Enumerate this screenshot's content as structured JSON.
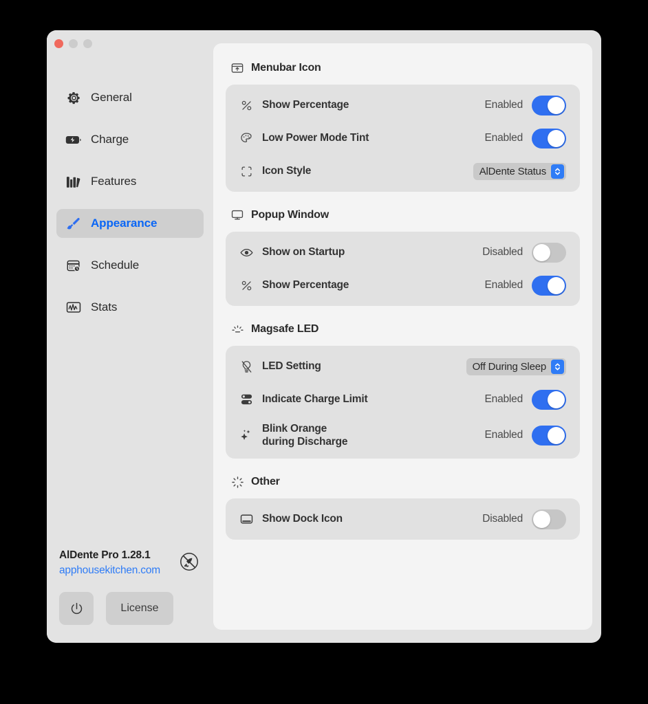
{
  "window": {
    "traffic_lights": [
      "close",
      "minimize",
      "zoom"
    ]
  },
  "sidebar": {
    "items": [
      {
        "label": "General",
        "icon": "gear-icon",
        "active": false
      },
      {
        "label": "Charge",
        "icon": "battery-bolt-icon",
        "active": false
      },
      {
        "label": "Features",
        "icon": "books-icon",
        "active": false
      },
      {
        "label": "Appearance",
        "icon": "paintbrush-icon",
        "active": true
      },
      {
        "label": "Schedule",
        "icon": "calendar-clock-icon",
        "active": false
      },
      {
        "label": "Stats",
        "icon": "waveform-chart-icon",
        "active": false
      }
    ],
    "footer": {
      "app_version": "AlDente Pro 1.28.1",
      "website": "apphousekitchen.com",
      "rocket_icon": "rocket-slash-icon",
      "power_icon": "power-icon",
      "license_label": "License"
    }
  },
  "colors": {
    "accent_blue": "#2f6ff0",
    "link_blue": "#2f7cf6",
    "toggle_off": "#c6c6c6",
    "card_bg": "#e1e1e1",
    "content_bg": "#f4f4f4",
    "sidebar_bg": "#e3e3e3"
  },
  "content": {
    "sections": [
      {
        "title": "Menubar Icon",
        "icon": "menubar-icon",
        "rows": [
          {
            "label": "Show Percentage",
            "icon": "percent-icon",
            "control": "toggle",
            "state": "Enabled",
            "on": true
          },
          {
            "label": "Low Power Mode Tint",
            "icon": "palette-icon",
            "control": "toggle",
            "state": "Enabled",
            "on": true
          },
          {
            "label": "Icon Style",
            "icon": "viewfinder-icon",
            "control": "popup",
            "value": "AlDente Status"
          }
        ]
      },
      {
        "title": "Popup Window",
        "icon": "display-icon",
        "rows": [
          {
            "label": "Show on Startup",
            "icon": "eye-icon",
            "control": "toggle",
            "state": "Disabled",
            "on": false
          },
          {
            "label": "Show Percentage",
            "icon": "percent-icon",
            "control": "toggle",
            "state": "Enabled",
            "on": true
          }
        ]
      },
      {
        "title": "Magsafe LED",
        "icon": "light-rays-icon",
        "rows": [
          {
            "label": "LED Setting",
            "icon": "lightbulb-slash-icon",
            "control": "popup",
            "value": "Off During Sleep"
          },
          {
            "label": "Indicate Charge Limit",
            "icon": "charge-limit-icon",
            "control": "toggle",
            "state": "Enabled",
            "on": true
          },
          {
            "label": "Blink Orange\nduring Discharge",
            "label_line1": "Blink Orange",
            "label_line2": "during Discharge",
            "icon": "sparkles-icon",
            "control": "toggle",
            "state": "Enabled",
            "on": true
          }
        ]
      },
      {
        "title": "Other",
        "icon": "spinner-rays-icon",
        "rows": [
          {
            "label": "Show Dock Icon",
            "icon": "dock-icon",
            "control": "toggle",
            "state": "Disabled",
            "on": false
          }
        ]
      }
    ]
  }
}
